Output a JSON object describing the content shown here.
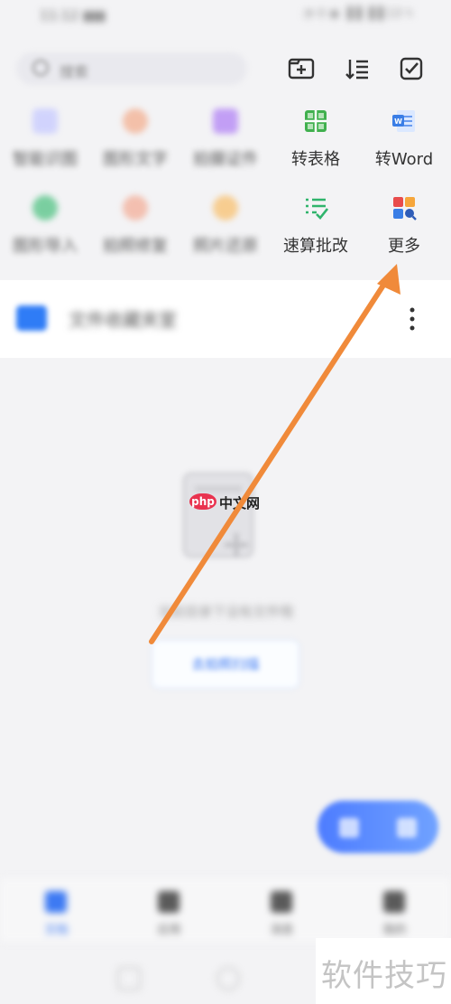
{
  "status_bar": {
    "time": "11:12 ▮▮▮",
    "right": "◔ ⚲ ◉ ▐▐ ▐▐ 13 ϟ"
  },
  "search": {
    "placeholder": "搜索"
  },
  "tools": [
    {
      "label": "智能识图",
      "blurred": true,
      "color": "#9fa6ff"
    },
    {
      "label": "图形文字",
      "blurred": true,
      "color": "#f08a5d"
    },
    {
      "label": "拍摄证件",
      "blurred": true,
      "color": "#a063f2"
    },
    {
      "label": "转表格",
      "blurred": false,
      "color": "#40b04e"
    },
    {
      "label": "转Word",
      "blurred": false,
      "color": "#3a7ee6"
    },
    {
      "label": "图形导入",
      "blurred": true,
      "color": "#32b46c"
    },
    {
      "label": "拍照修复",
      "blurred": true,
      "color": "#f08e6e"
    },
    {
      "label": "照片还原",
      "blurred": true,
      "color": "#f6a63b"
    },
    {
      "label": "速算批改",
      "blurred": false,
      "color": "#2fb46c"
    },
    {
      "label": "更多",
      "blurred": false,
      "color": "#e84c4c"
    }
  ],
  "folder": {
    "label": "文件收藏夹室"
  },
  "empty_state": {
    "text": "当前目录下没有文件哦",
    "button": "去拍照扫描"
  },
  "watermark": {
    "php": "php",
    "cn": "中文网"
  },
  "bottom_nav": [
    {
      "label": "文档",
      "active": true
    },
    {
      "label": "应用",
      "active": false
    },
    {
      "label": "消息",
      "active": false
    },
    {
      "label": "我的",
      "active": false
    }
  ],
  "corner_watermark": "软件技巧",
  "colors": {
    "accent": "#3d7af3",
    "arrow": "#f08a3a",
    "folder": "#2f7cf6"
  }
}
